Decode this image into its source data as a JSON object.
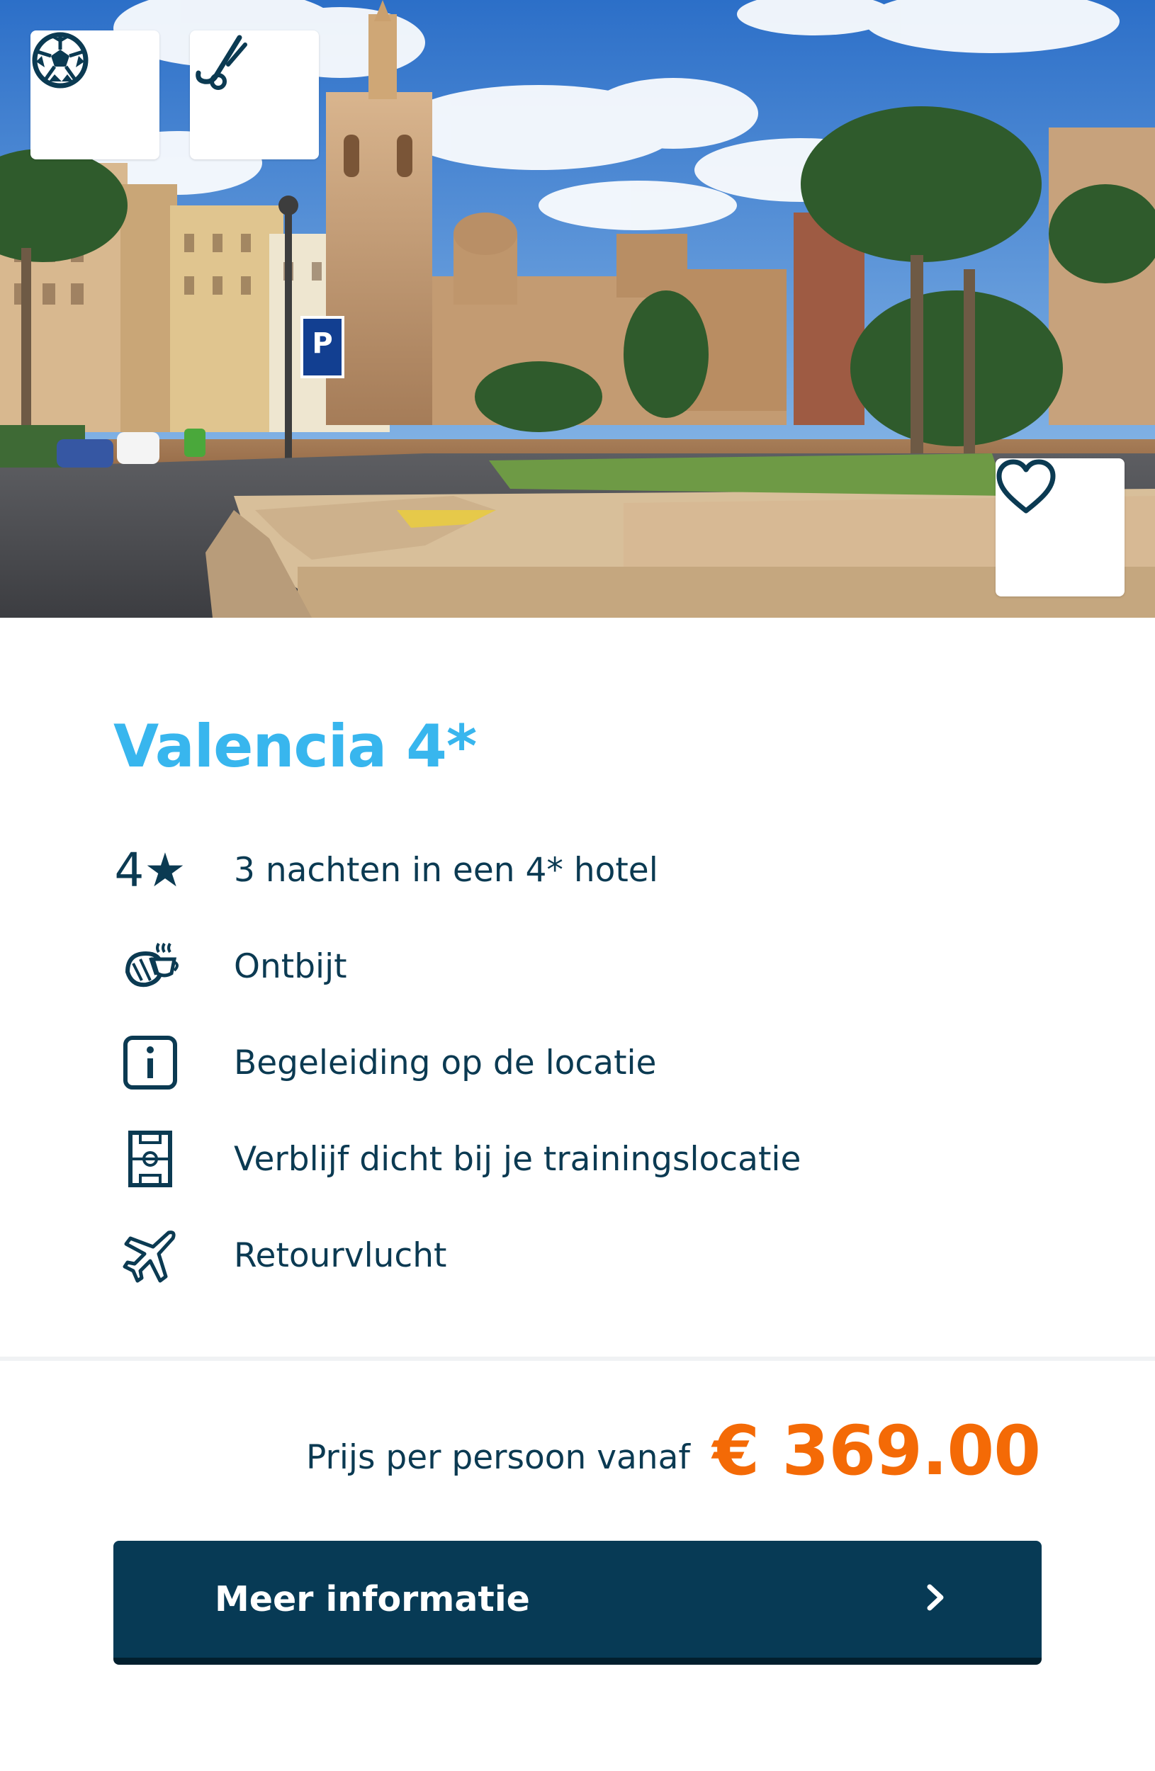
{
  "card": {
    "title": "Valencia 4*",
    "features": [
      {
        "icon": "four-star-icon",
        "text": "3 nachten in een 4* hotel"
      },
      {
        "icon": "breakfast-icon",
        "text": "Ontbijt"
      },
      {
        "icon": "info-icon",
        "text": "Begeleiding op de locatie"
      },
      {
        "icon": "field-icon",
        "text": "Verblijf dicht bij je trainingslocatie"
      },
      {
        "icon": "flight-icon",
        "text": "Retourvlucht"
      }
    ],
    "price_label": "Prijs per persoon vanaf",
    "price_value": "€ 369.00",
    "cta_label": "Meer informatie",
    "four_star_glyph": "4★"
  },
  "hero": {
    "sport_tags": [
      "football-icon",
      "hockey-icon"
    ],
    "favorite_icon": "heart-icon",
    "parking_sign": "P"
  },
  "colors": {
    "title": "#38b6ee",
    "text": "#0b3a52",
    "price": "#f46a06",
    "cta_bg": "#073a55"
  }
}
